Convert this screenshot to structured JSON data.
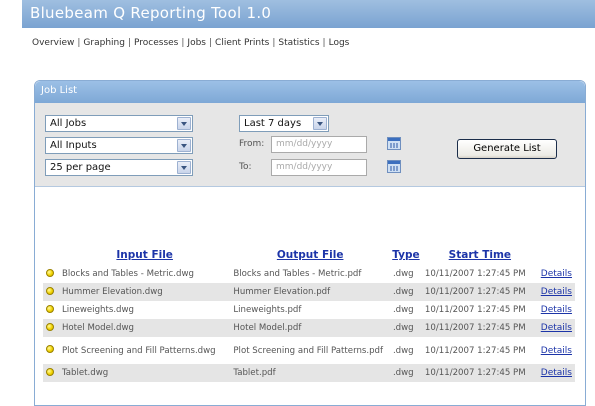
{
  "app": {
    "title": "Bluebeam Q Reporting Tool 1.0"
  },
  "nav": [
    "Overview",
    "Graphing",
    "Processes",
    "Jobs",
    "Client Prints",
    "Statistics",
    "Logs"
  ],
  "panel": {
    "title": "Job List"
  },
  "filters": {
    "job_type": "All Jobs",
    "inputs": "All Inputs",
    "per_page": "25 per page",
    "range": "Last 7 days",
    "from_label": "From:",
    "from_placeholder": "mm/dd/yyyy",
    "to_label": "To:",
    "to_placeholder": "mm/dd/yyyy",
    "generate_label": "Generate List"
  },
  "table": {
    "headers": [
      "Input File",
      "Output File",
      "Type",
      "Start Time"
    ],
    "rows": [
      {
        "input": "Blocks and Tables - Metric.dwg",
        "output": "Blocks and Tables - Metric.pdf",
        "type": ".dwg",
        "start": "10/11/2007 1:27:45 PM",
        "details": "Details"
      },
      {
        "input": "Hummer Elevation.dwg",
        "output": "Hummer Elevation.pdf",
        "type": ".dwg",
        "start": "10/11/2007 1:27:45 PM",
        "details": "Details"
      },
      {
        "input": "Lineweights.dwg",
        "output": "Lineweights.pdf",
        "type": ".dwg",
        "start": "10/11/2007 1:27:45 PM",
        "details": "Details"
      },
      {
        "input": "Hotel Model.dwg",
        "output": "Hotel Model.pdf",
        "type": ".dwg",
        "start": "10/11/2007 1:27:45 PM",
        "details": "Details"
      },
      {
        "input": "Plot Screening and Fill Patterns.dwg",
        "output": "Plot Screening and Fill Patterns.pdf",
        "type": ".dwg",
        "start": "10/11/2007 1:27:45 PM",
        "details": "Details"
      },
      {
        "input": "Tablet.dwg",
        "output": "Tablet.pdf",
        "type": ".dwg",
        "start": "10/11/2007 1:27:45 PM",
        "details": "Details"
      }
    ]
  },
  "icons": {
    "status": "status-dot-yellow-icon",
    "calendar": "calendar-icon"
  },
  "colors": {
    "header_blue": "#7aa3d1",
    "link_blue": "#1c34a8",
    "status_yellow": "#f2d400"
  }
}
